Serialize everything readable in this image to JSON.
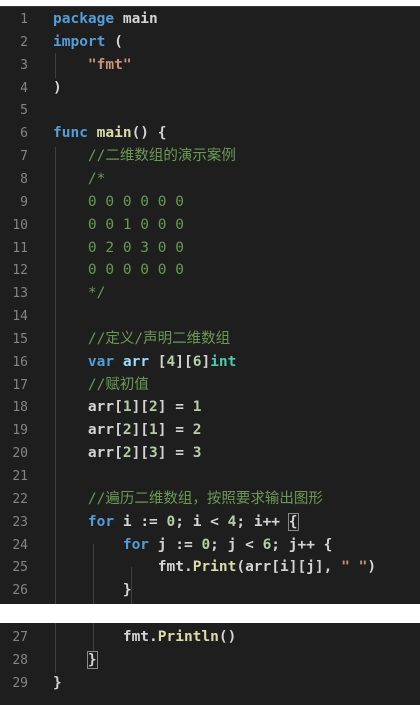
{
  "panel1_lines": [
    {
      "n": "1",
      "t": [
        [
          "kw",
          "package"
        ],
        [
          "",
          " main"
        ]
      ]
    },
    {
      "n": "2",
      "t": [
        [
          "kw",
          "import"
        ],
        [
          "",
          " ("
        ]
      ]
    },
    {
      "n": "3",
      "t": [
        [
          "",
          "    "
        ],
        [
          "str",
          "\"fmt\""
        ]
      ]
    },
    {
      "n": "4",
      "t": [
        [
          "",
          ")"
        ]
      ]
    },
    {
      "n": "5",
      "t": []
    },
    {
      "n": "6",
      "t": [
        [
          "kw",
          "func"
        ],
        [
          "",
          " "
        ],
        [
          "fn",
          "main"
        ],
        [
          "",
          "() {"
        ]
      ]
    },
    {
      "n": "7",
      "t": [
        [
          "",
          "    "
        ],
        [
          "com",
          "//二维数组的演示案例"
        ]
      ]
    },
    {
      "n": "8",
      "t": [
        [
          "",
          "    "
        ],
        [
          "com",
          "/*"
        ]
      ]
    },
    {
      "n": "9",
      "t": [
        [
          "",
          "    "
        ],
        [
          "com",
          "0 0 0 0 0 0"
        ]
      ]
    },
    {
      "n": "10",
      "t": [
        [
          "",
          "    "
        ],
        [
          "com",
          "0 0 1 0 0 0"
        ]
      ]
    },
    {
      "n": "11",
      "t": [
        [
          "",
          "    "
        ],
        [
          "com",
          "0 2 0 3 0 0"
        ]
      ]
    },
    {
      "n": "12",
      "t": [
        [
          "",
          "    "
        ],
        [
          "com",
          "0 0 0 0 0 0"
        ]
      ]
    },
    {
      "n": "13",
      "t": [
        [
          "",
          "    "
        ],
        [
          "com",
          "*/"
        ]
      ]
    },
    {
      "n": "14",
      "t": []
    },
    {
      "n": "15",
      "t": [
        [
          "",
          "    "
        ],
        [
          "com",
          "//定义/声明二维数组"
        ]
      ]
    },
    {
      "n": "16",
      "t": [
        [
          "",
          "    "
        ],
        [
          "kw",
          "var"
        ],
        [
          "",
          " "
        ],
        [
          "var",
          "arr"
        ],
        [
          "",
          " ["
        ],
        [
          "num",
          "4"
        ],
        [
          "",
          "]["
        ],
        [
          "num",
          "6"
        ],
        [
          "",
          "]"
        ],
        [
          "typ",
          "int"
        ]
      ]
    },
    {
      "n": "17",
      "t": [
        [
          "",
          "    "
        ],
        [
          "com",
          "//赋初值"
        ]
      ]
    },
    {
      "n": "18",
      "t": [
        [
          "",
          "    arr["
        ],
        [
          "num",
          "1"
        ],
        [
          "",
          "]["
        ],
        [
          "num",
          "2"
        ],
        [
          "",
          "] = "
        ],
        [
          "num",
          "1"
        ]
      ]
    },
    {
      "n": "19",
      "t": [
        [
          "",
          "    arr["
        ],
        [
          "num",
          "2"
        ],
        [
          "",
          "]["
        ],
        [
          "num",
          "1"
        ],
        [
          "",
          "] = "
        ],
        [
          "num",
          "2"
        ]
      ]
    },
    {
      "n": "20",
      "t": [
        [
          "",
          "    arr["
        ],
        [
          "num",
          "2"
        ],
        [
          "",
          "]["
        ],
        [
          "num",
          "3"
        ],
        [
          "",
          "] = "
        ],
        [
          "num",
          "3"
        ]
      ]
    },
    {
      "n": "21",
      "t": []
    },
    {
      "n": "22",
      "t": [
        [
          "",
          "    "
        ],
        [
          "com",
          "//遍历二维数组，按照要求输出图形"
        ]
      ]
    },
    {
      "n": "23",
      "t": [
        [
          "",
          "    "
        ],
        [
          "kw",
          "for"
        ],
        [
          "",
          " i := "
        ],
        [
          "num",
          "0"
        ],
        [
          "",
          "; i < "
        ],
        [
          "num",
          "4"
        ],
        [
          "",
          "; i++ "
        ],
        [
          "brk",
          "{"
        ]
      ]
    },
    {
      "n": "24",
      "t": [
        [
          "",
          "        "
        ],
        [
          "kw",
          "for"
        ],
        [
          "",
          " j := "
        ],
        [
          "num",
          "0"
        ],
        [
          "",
          "; j < "
        ],
        [
          "num",
          "6"
        ],
        [
          "",
          "; j++ {"
        ]
      ]
    },
    {
      "n": "25",
      "t": [
        [
          "",
          "            fmt."
        ],
        [
          "fn",
          "Print"
        ],
        [
          "",
          "(arr[i][j], "
        ],
        [
          "str",
          "\" \""
        ],
        [
          "",
          ")"
        ]
      ]
    },
    {
      "n": "26",
      "t": [
        [
          "",
          "        }"
        ]
      ]
    }
  ],
  "panel2_lines": [
    {
      "n": "27",
      "t": [
        [
          "",
          "        fmt."
        ],
        [
          "fn",
          "Println"
        ],
        [
          "",
          "()"
        ]
      ]
    },
    {
      "n": "28",
      "t": [
        [
          "",
          "    "
        ],
        [
          "brk",
          "}"
        ]
      ]
    },
    {
      "n": "29",
      "t": [
        [
          "",
          "}"
        ]
      ]
    }
  ]
}
